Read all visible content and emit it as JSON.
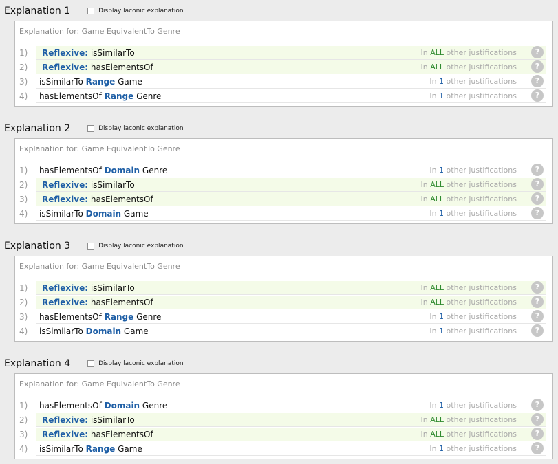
{
  "laconic_label": "Display laconic explanation",
  "explanations": [
    {
      "title": "Explanation 1",
      "for": "Explanation for: Game EquivalentTo Genre",
      "rows": [
        {
          "num": "1)",
          "pre": "",
          "kw": "Reflexive:",
          "post": " isSimilarTo",
          "count": "ALL",
          "kind": "all"
        },
        {
          "num": "2)",
          "pre": "",
          "kw": "Reflexive:",
          "post": " hasElementsOf",
          "count": "ALL",
          "kind": "all"
        },
        {
          "num": "3)",
          "pre": "isSimilarTo ",
          "kw": "Range",
          "post": " Game",
          "count": "1",
          "kind": "num"
        },
        {
          "num": "4)",
          "pre": "hasElementsOf ",
          "kw": "Range",
          "post": " Genre",
          "count": "1",
          "kind": "num"
        }
      ]
    },
    {
      "title": "Explanation 2",
      "for": "Explanation for: Game EquivalentTo Genre",
      "rows": [
        {
          "num": "1)",
          "pre": "hasElementsOf ",
          "kw": "Domain",
          "post": " Genre",
          "count": "1",
          "kind": "num"
        },
        {
          "num": "2)",
          "pre": "",
          "kw": "Reflexive:",
          "post": " isSimilarTo",
          "count": "ALL",
          "kind": "all"
        },
        {
          "num": "3)",
          "pre": "",
          "kw": "Reflexive:",
          "post": " hasElementsOf",
          "count": "ALL",
          "kind": "all"
        },
        {
          "num": "4)",
          "pre": "isSimilarTo ",
          "kw": "Domain",
          "post": " Game",
          "count": "1",
          "kind": "num"
        }
      ]
    },
    {
      "title": "Explanation 3",
      "for": "Explanation for: Game EquivalentTo Genre",
      "rows": [
        {
          "num": "1)",
          "pre": "",
          "kw": "Reflexive:",
          "post": " isSimilarTo",
          "count": "ALL",
          "kind": "all"
        },
        {
          "num": "2)",
          "pre": "",
          "kw": "Reflexive:",
          "post": " hasElementsOf",
          "count": "ALL",
          "kind": "all"
        },
        {
          "num": "3)",
          "pre": "hasElementsOf ",
          "kw": "Range",
          "post": " Genre",
          "count": "1",
          "kind": "num"
        },
        {
          "num": "4)",
          "pre": "isSimilarTo ",
          "kw": "Domain",
          "post": " Game",
          "count": "1",
          "kind": "num"
        }
      ]
    },
    {
      "title": "Explanation 4",
      "for": "Explanation for: Game EquivalentTo Genre",
      "rows": [
        {
          "num": "1)",
          "pre": "hasElementsOf ",
          "kw": "Domain",
          "post": " Genre",
          "count": "1",
          "kind": "num"
        },
        {
          "num": "2)",
          "pre": "",
          "kw": "Reflexive:",
          "post": " isSimilarTo",
          "count": "ALL",
          "kind": "all"
        },
        {
          "num": "3)",
          "pre": "",
          "kw": "Reflexive:",
          "post": " hasElementsOf",
          "count": "ALL",
          "kind": "all"
        },
        {
          "num": "4)",
          "pre": "isSimilarTo ",
          "kw": "Range",
          "post": " Game",
          "count": "1",
          "kind": "num"
        }
      ]
    }
  ],
  "just_prefix": "In ",
  "just_suffix": " other justifications",
  "help_glyph": "?",
  "colors": {
    "keyword": "#1f5fa6",
    "all_count": "#2f8a2f",
    "highlight_row": "#f4fbe8"
  }
}
